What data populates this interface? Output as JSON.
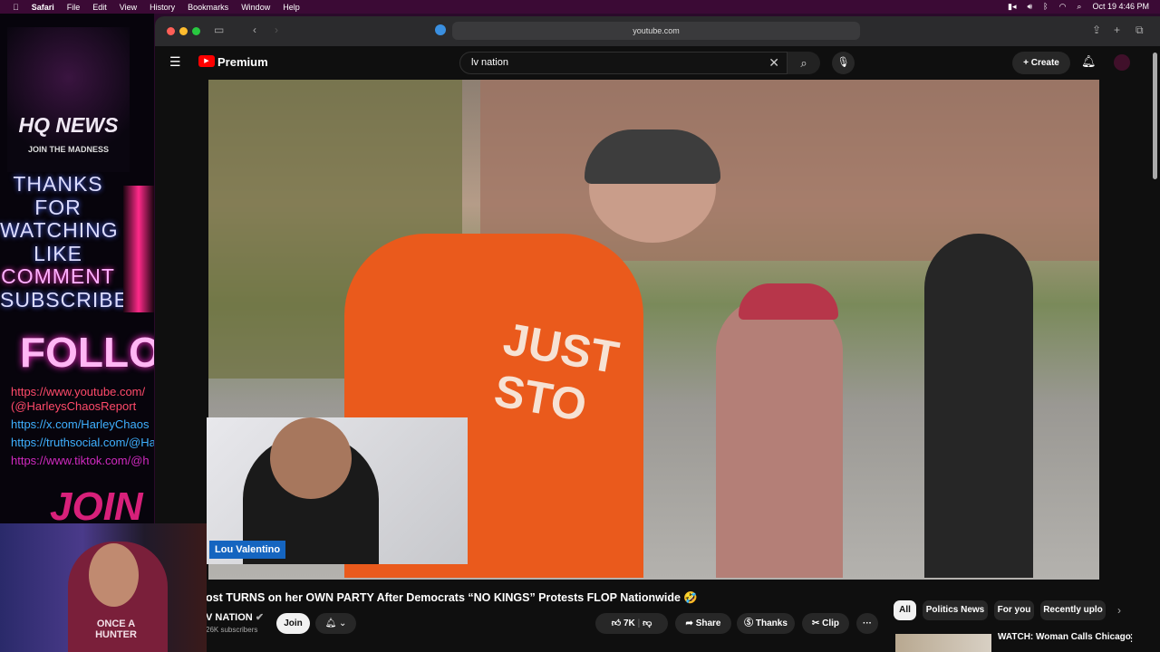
{
  "menubar": {
    "apple": "",
    "items": [
      "Safari",
      "File",
      "Edit",
      "View",
      "History",
      "Bookmarks",
      "Window",
      "Help"
    ],
    "datetime": "Oct 19  4:46 PM"
  },
  "overlay": {
    "logo_title": "HQ NEWS",
    "logo_tagline": "JOIN THE MADNESS",
    "thanks_lines": [
      "THANKS",
      "FOR",
      "WATCHING",
      "LIKE",
      "COMMENT",
      "SUBSCRIBE"
    ],
    "follow": "FOLLOW",
    "links": [
      "https://www.youtube.com/",
      "(@HarleysChaosReport",
      "https://x.com/HarleyChaos",
      "https://truthsocial.com/@Ha",
      "https://www.tiktok.com/@h"
    ],
    "join": "JOIN T"
  },
  "browser": {
    "url": "youtube.com"
  },
  "youtube": {
    "brand": "Premium",
    "search_value": "lv nation",
    "create_label": "Create"
  },
  "video": {
    "shirt_text": "JUST STO",
    "inset_name": "Lou Valentino",
    "title": "ost TURNS on her OWN PARTY After Democrats “NO KINGS” Protests FLOP Nationwide 🤣",
    "channel": "V NATION",
    "subscribers": "26K subscribers",
    "join_label": "Join",
    "likes": "7K",
    "share_label": "Share",
    "thanks_label": "Thanks",
    "clip_label": "Clip",
    "more_label": "···"
  },
  "chips": [
    "All",
    "Politics News",
    "For you",
    "Recently uplo"
  ],
  "recommendation": {
    "title": "WATCH: Woman Calls Chicago"
  },
  "webcam": {
    "shirt_text": "ONCE A HUNTER"
  }
}
